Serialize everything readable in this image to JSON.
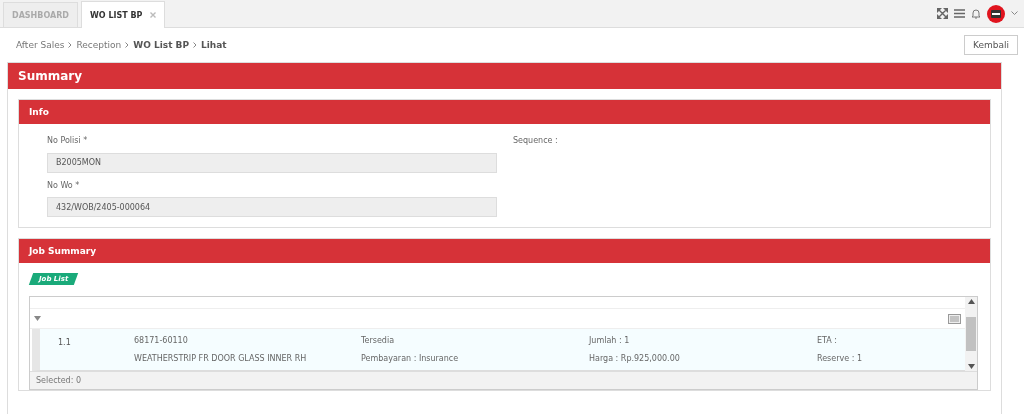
{
  "tabs": [
    {
      "label": "DASHBOARD",
      "selected": false,
      "closable": false
    },
    {
      "label": "WO LIST BP",
      "selected": true,
      "closable": true
    }
  ],
  "breadcrumb": [
    {
      "label": "After Sales",
      "current": false
    },
    {
      "label": "Reception",
      "current": false
    },
    {
      "label": "WO List BP",
      "current": true
    },
    {
      "label": "Lihat",
      "current": true
    }
  ],
  "back_button": "Kembali",
  "summary": {
    "title": "Summary",
    "info": {
      "title": "Info",
      "fields": [
        {
          "label": "No Polisi *",
          "value": "B2005MON"
        },
        {
          "label": "No Wo *",
          "value": "432/WOB/2405-000064"
        }
      ],
      "sequence_label": "Sequence :"
    },
    "job_summary": {
      "title": "Job Summary",
      "badge": "Job List",
      "rows": [
        {
          "number": "1.1",
          "selected": false,
          "cells": [
            [
              "68171-60110",
              "WEATHERSTRIP FR DOOR GLASS INNER RH"
            ],
            [
              "Tersedia",
              "Pembayaran : Insurance"
            ],
            [
              "Jumlah : 1",
              "Harga : Rp.925,000.00"
            ],
            [
              "ETA :",
              "Reserve : 1"
            ]
          ]
        }
      ],
      "footer": "Selected: 0"
    }
  }
}
